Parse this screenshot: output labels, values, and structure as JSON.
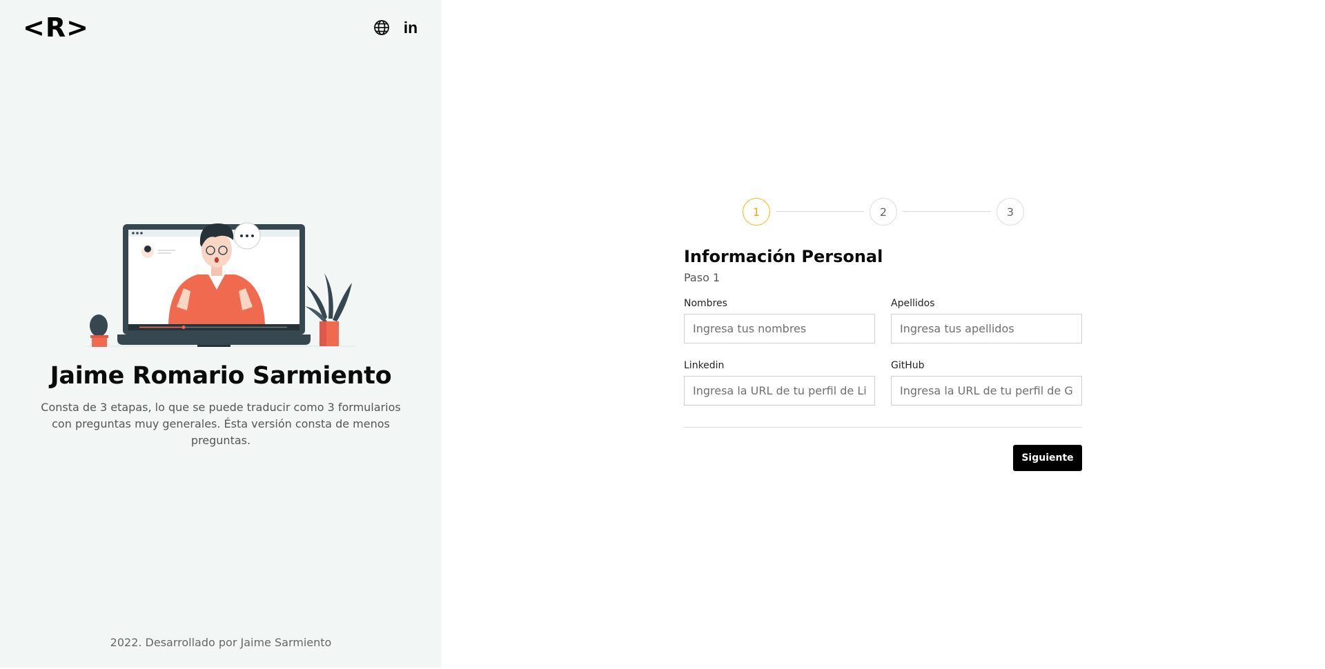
{
  "header": {
    "logo": "<R>",
    "icons": [
      "globe-icon",
      "linkedin-icon"
    ],
    "linkedin_text": "in"
  },
  "profile": {
    "name": "Jaime Romario Sarmiento",
    "description": "Consta de 3 etapas, lo que se puede traducir como 3 formularios con preguntas muy generales. Ésta versión consta de menos preguntas."
  },
  "footer": "2022. Desarrollado por Jaime Sarmiento",
  "stepper": {
    "steps": [
      "1",
      "2",
      "3"
    ],
    "active_step": 1,
    "active_color": "#f5b71c"
  },
  "form": {
    "title": "Información Personal",
    "subtitle": "Paso 1",
    "fields": {
      "nombres": {
        "label": "Nombres",
        "placeholder": "Ingresa tus nombres",
        "value": ""
      },
      "apellidos": {
        "label": "Apellidos",
        "placeholder": "Ingresa tus apellidos",
        "value": ""
      },
      "linkedin": {
        "label": "Linkedin",
        "placeholder": "Ingresa la URL de tu perfil de Linkedin",
        "value": ""
      },
      "github": {
        "label": "GitHub",
        "placeholder": "Ingresa la URL de tu perfil de GitHub",
        "value": ""
      }
    },
    "next_label": "Siguiente"
  },
  "colors": {
    "left_panel_bg": "#f2f6f5",
    "accent_orange": "#f06a4f",
    "laptop_dark": "#37474f"
  }
}
